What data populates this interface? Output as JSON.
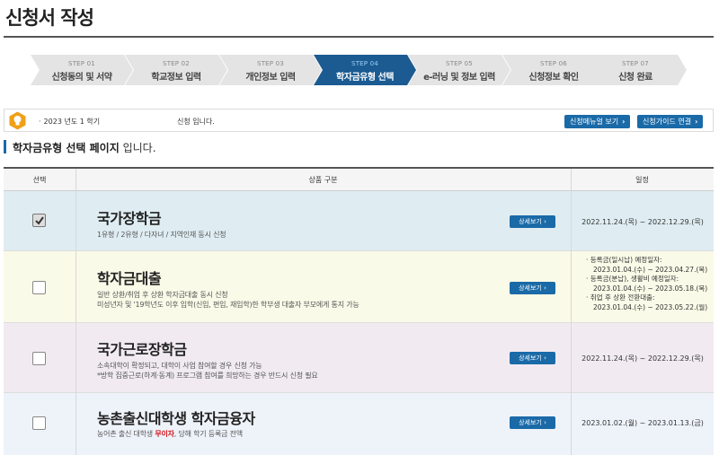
{
  "page": {
    "title": "신청서 작성"
  },
  "steps": [
    {
      "no": "STEP 01",
      "label": "신청동의 및 서약",
      "active": false
    },
    {
      "no": "STEP 02",
      "label": "학교정보 입력",
      "active": false
    },
    {
      "no": "STEP 03",
      "label": "개인정보 입력",
      "active": false
    },
    {
      "no": "STEP 04",
      "label": "학자금유형 선택",
      "active": true
    },
    {
      "no": "STEP 05",
      "label": "e-러닝 및 정보 입력",
      "active": false
    },
    {
      "no": "STEP 06",
      "label": "신청정보 확인",
      "active": false
    },
    {
      "no": "STEP 07",
      "label": "신청 완료",
      "active": false
    }
  ],
  "info": {
    "semester": "2023 년도 1 학기",
    "status": "신청 입니다.",
    "manual_button": "신청메뉴얼 보기",
    "guide_button": "신청가이드 연결"
  },
  "section": {
    "title_bold": "학자금유형 선택 페이지",
    "title_rest": " 입니다."
  },
  "table": {
    "headers": {
      "select": "선택",
      "product": "상품 구분",
      "schedule": "일정"
    },
    "detail_label": "상세보기",
    "rows": [
      {
        "checked": true,
        "name": "국가장학금",
        "desc": [
          "1유형 / 2유형 / 다자녀 / 지역인재 동시 신청"
        ],
        "schedule": "2022.11.24.(목) ~ 2022.12.29.(목)",
        "bg": "#dfedf2"
      },
      {
        "checked": false,
        "name": "학자금대출",
        "desc": [
          "일반 상환/취업 후 상환 학자금대출 동시 신청",
          "미성년자 및 '19학년도 이후 입학(신입, 편입, 재입학)한 학부생 대출자 부모에게 통지 가능"
        ],
        "schedule_list": [
          {
            "title": "· 등록금(일시납) 예정일자:",
            "date": "2023.01.04.(수) ~ 2023.04.27.(목)"
          },
          {
            "title": "· 등록금(분납), 생활비 예정일자:",
            "date": "2023.01.04.(수) ~ 2023.05.18.(목)"
          },
          {
            "title": "· 취업 후 상환 전환대출:",
            "date": "2023.01.04.(수) ~ 2023.05.22.(월)"
          }
        ],
        "bg": "#fafae8"
      },
      {
        "checked": false,
        "name": "국가근로장학금",
        "desc": [
          "소속대학이 확정되고, 대학이 사업 참여할 경우 신청 가능",
          "*방학 집중근로(하계·동계) 프로그램 참여를 희망하는 경우 반드시 신청 필요"
        ],
        "schedule": "2022.11.24.(목) ~ 2022.12.29.(목)",
        "bg": "#f1ebf1"
      },
      {
        "checked": false,
        "name": "농촌출신대학생 학자금융자",
        "desc_a": "농어촌 출신 대학생 ",
        "desc_red": "무이자",
        "desc_b": ", 당해 학기 등록금 전액",
        "schedule": "2023.01.02.(월) ~ 2023.01.13.(금)",
        "bg": "#eef3fa"
      }
    ]
  },
  "colors": {
    "accent": "#1a6aa8",
    "step_active": "#1b5b92",
    "step_inactive": "#e4e4e4"
  }
}
